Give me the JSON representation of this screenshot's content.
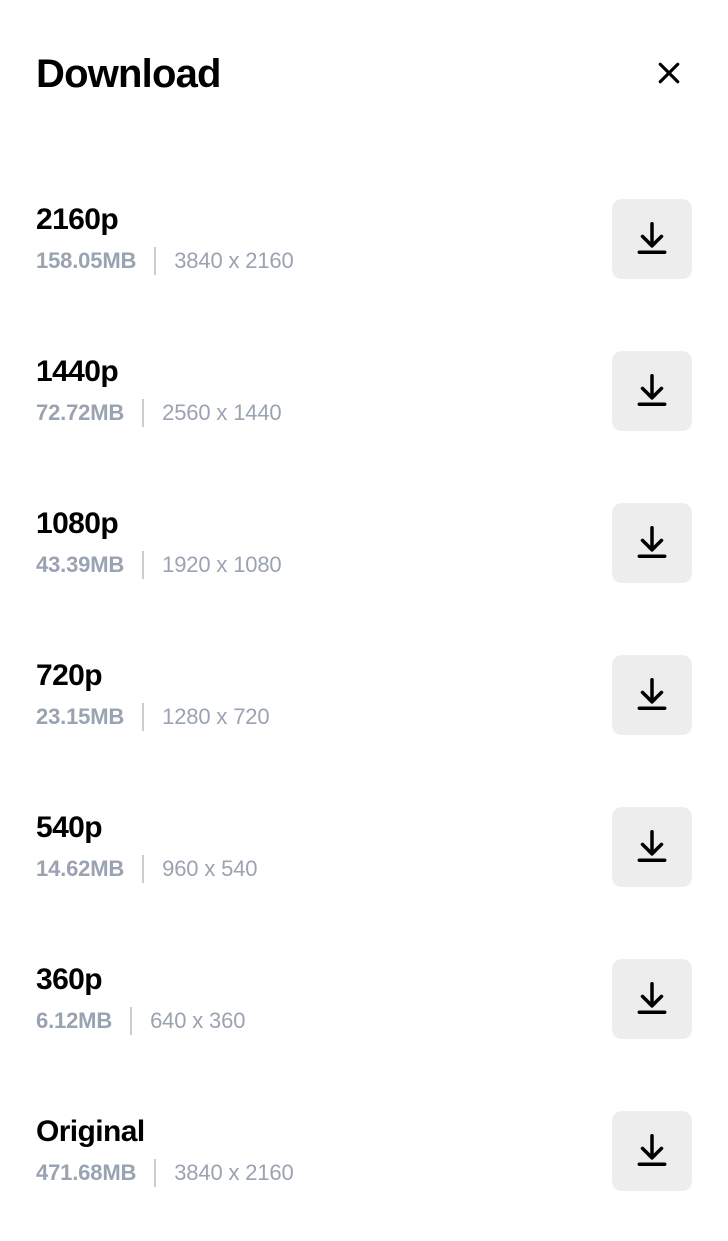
{
  "title": "Download",
  "options": [
    {
      "label": "2160p",
      "size": "158.05MB",
      "dims": "3840 x 2160"
    },
    {
      "label": "1440p",
      "size": "72.72MB",
      "dims": "2560 x 1440"
    },
    {
      "label": "1080p",
      "size": "43.39MB",
      "dims": "1920 x 1080"
    },
    {
      "label": "720p",
      "size": "23.15MB",
      "dims": "1280 x 720"
    },
    {
      "label": "540p",
      "size": "14.62MB",
      "dims": "960 x 540"
    },
    {
      "label": "360p",
      "size": "6.12MB",
      "dims": "640 x 360"
    },
    {
      "label": "Original",
      "size": "471.68MB",
      "dims": "3840 x 2160"
    }
  ]
}
